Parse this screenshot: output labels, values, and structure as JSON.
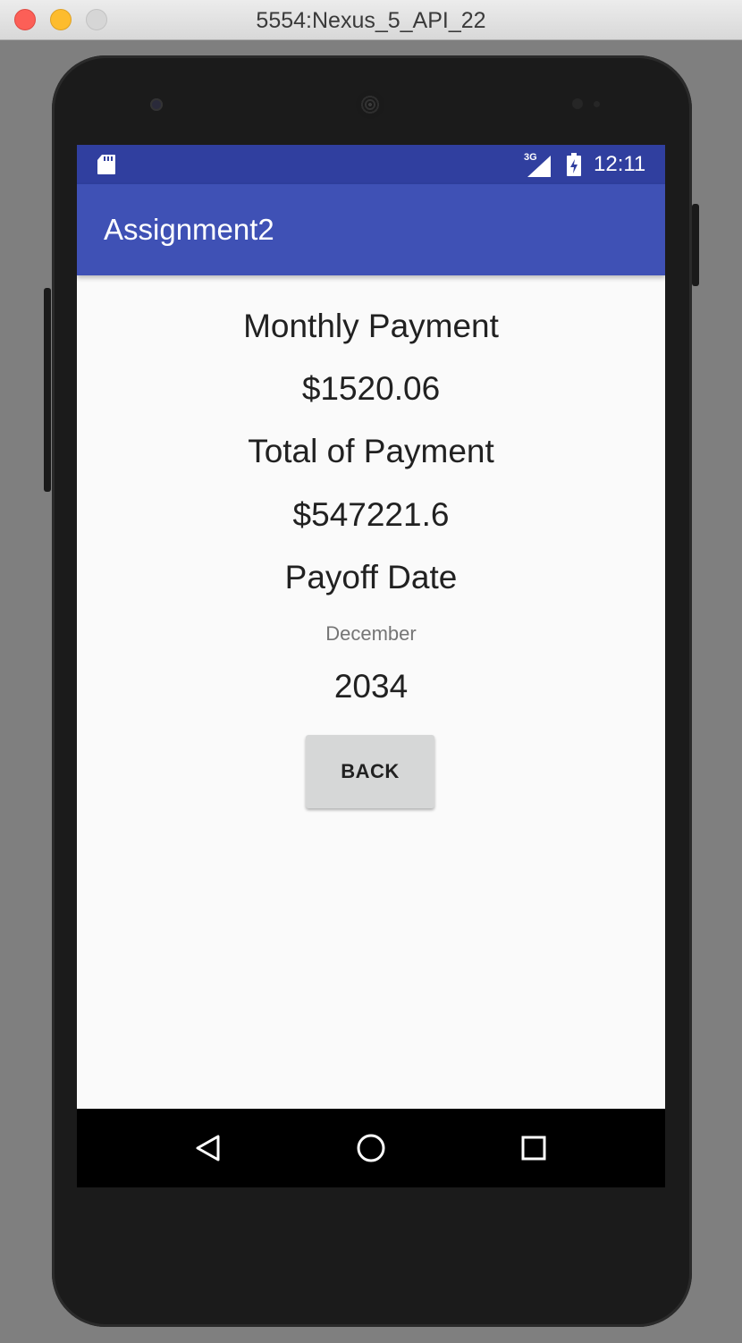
{
  "window": {
    "title": "5554:Nexus_5_API_22"
  },
  "status_bar": {
    "network_type": "3G",
    "time": "12:11",
    "icons": [
      "sd-card-icon",
      "signal-icon",
      "battery-charging-icon"
    ]
  },
  "app_bar": {
    "title": "Assignment2"
  },
  "content": {
    "monthly_payment_label": "Monthly Payment",
    "monthly_payment_value": "$1520.06",
    "total_payment_label": "Total of Payment",
    "total_payment_value": "$547221.6",
    "payoff_date_label": "Payoff Date",
    "payoff_month": "December",
    "payoff_year": "2034",
    "back_button_label": "BACK"
  },
  "nav_bar": {
    "buttons": [
      "back-icon",
      "home-icon",
      "recents-icon"
    ]
  },
  "colors": {
    "status_bar": "#303f9f",
    "app_bar": "#3f51b5",
    "screen_background": "#fafafa",
    "button_background": "#d6d7d7"
  }
}
